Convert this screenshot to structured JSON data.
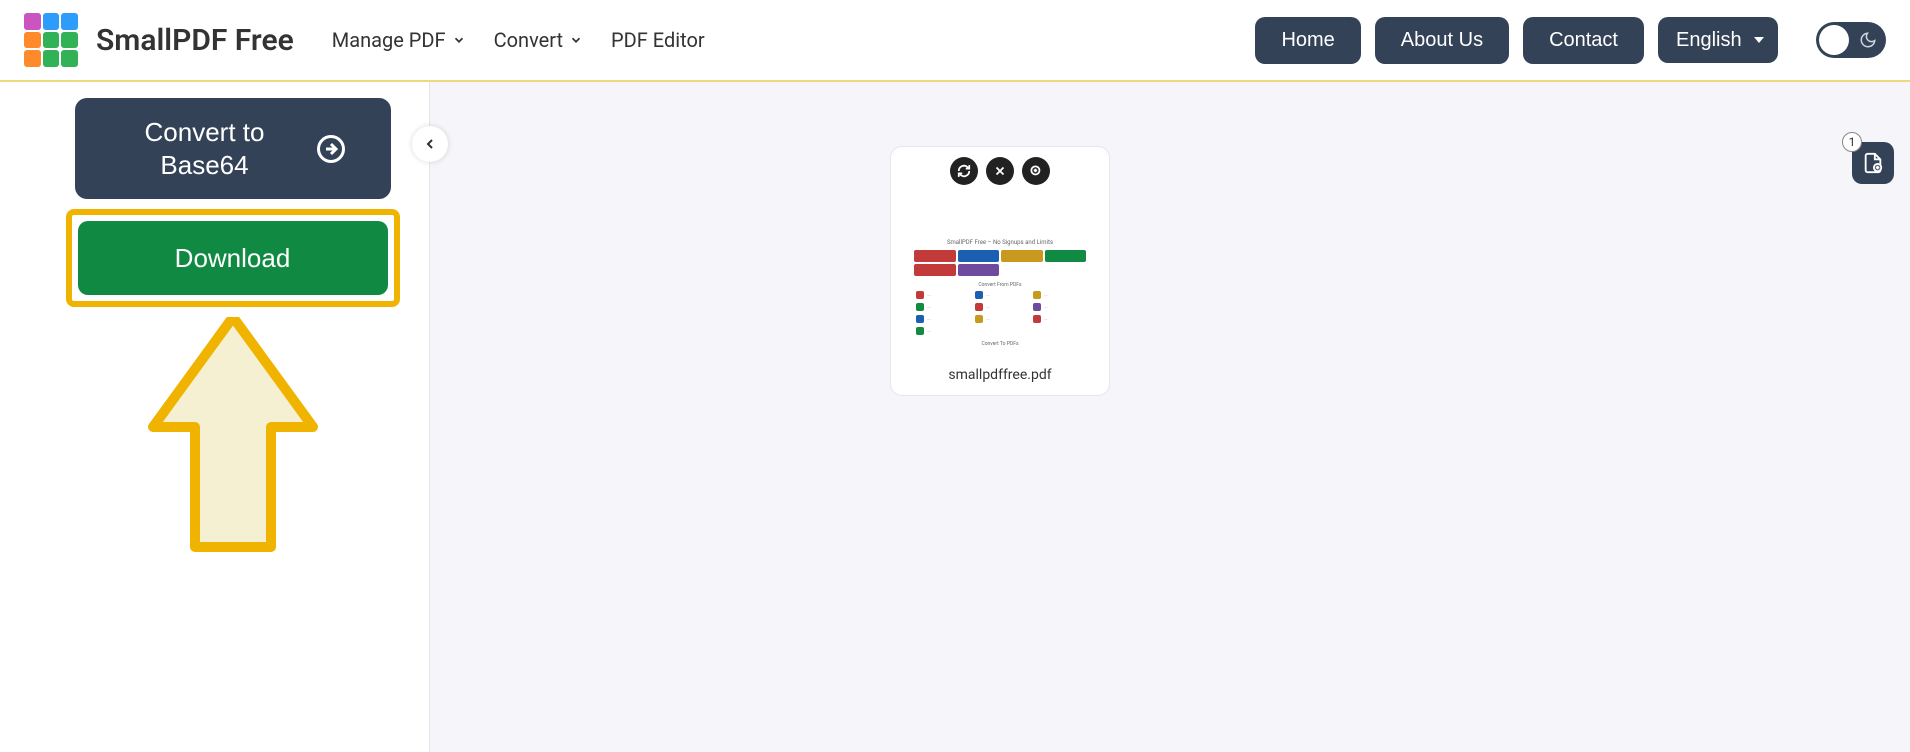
{
  "brand": "SmallPDF Free",
  "logo_colors": [
    "#cc54c0",
    "#2d9cfb",
    "#2d9cfb",
    "#ff8a2b",
    "#31b257",
    "#31b257",
    "#ff8a2b",
    "#31b257",
    "#31b257"
  ],
  "menu": {
    "manage": "Manage PDF",
    "convert": "Convert",
    "editor": "PDF Editor"
  },
  "nav": {
    "home": "Home",
    "about": "About Us",
    "contact": "Contact"
  },
  "language": {
    "selected": "English"
  },
  "sidebar": {
    "convert_label": "Convert to Base64",
    "download_label": "Download"
  },
  "file": {
    "name": "smallpdffree.pdf",
    "thumb_title": "SmallPDF Free – No Signups and Limits",
    "thumb_section1": "Convert From PDFs",
    "thumb_section2": "Convert To PDFs",
    "tile_colors": [
      "#c23a3a",
      "#1b5fb3",
      "#c79a1d",
      "#118a43",
      "#c23a3a",
      "#6f4b9f"
    ]
  },
  "badge_count": "1"
}
